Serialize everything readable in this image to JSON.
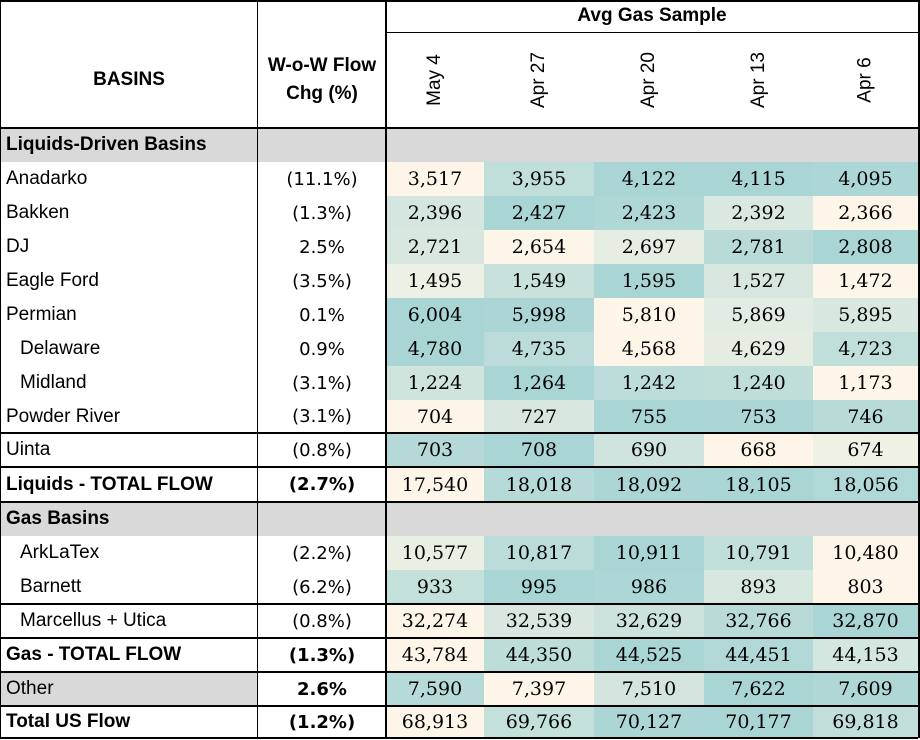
{
  "header": {
    "basins_label": "BASINS",
    "wow_label": "W-o-W Flow Chg (%)",
    "avg_label": "Avg Gas Sample",
    "dates": [
      "May 4",
      "Apr 27",
      "Apr 20",
      "Apr 13",
      "Apr 6"
    ]
  },
  "colors": {
    "heat_low": "#fdf6e8",
    "heat_high": "#a9d5d5",
    "section_gray": "#d9d9d9",
    "grid": "#000000"
  },
  "rows": [
    {
      "type": "section",
      "name": "Liquids-Driven Basins"
    },
    {
      "type": "data",
      "name": "Anadarko",
      "indent": false,
      "chg": "(11.1%)",
      "values": [
        "3,517",
        "3,955",
        "4,122",
        "4,115",
        "4,095"
      ]
    },
    {
      "type": "data",
      "name": "Bakken",
      "indent": false,
      "chg": "(1.3%)",
      "values": [
        "2,396",
        "2,427",
        "2,423",
        "2,392",
        "2,366"
      ]
    },
    {
      "type": "data",
      "name": "DJ",
      "indent": false,
      "chg": "2.5%",
      "values": [
        "2,721",
        "2,654",
        "2,697",
        "2,781",
        "2,808"
      ]
    },
    {
      "type": "data",
      "name": "Eagle Ford",
      "indent": false,
      "chg": "(3.5%)",
      "values": [
        "1,495",
        "1,549",
        "1,595",
        "1,527",
        "1,472"
      ]
    },
    {
      "type": "data",
      "name": "Permian",
      "indent": false,
      "chg": "0.1%",
      "values": [
        "6,004",
        "5,998",
        "5,810",
        "5,869",
        "5,895"
      ]
    },
    {
      "type": "data",
      "name": "Delaware",
      "indent": true,
      "chg": "0.9%",
      "values": [
        "4,780",
        "4,735",
        "4,568",
        "4,629",
        "4,723"
      ]
    },
    {
      "type": "data",
      "name": "Midland",
      "indent": true,
      "chg": "(3.1%)",
      "values": [
        "1,224",
        "1,264",
        "1,242",
        "1,240",
        "1,173"
      ]
    },
    {
      "type": "data",
      "name": "Powder River",
      "indent": false,
      "chg": "(3.1%)",
      "values": [
        "704",
        "727",
        "755",
        "753",
        "746"
      ]
    },
    {
      "type": "data",
      "name": "Uinta",
      "indent": false,
      "chg": "(0.8%)",
      "values": [
        "703",
        "708",
        "690",
        "668",
        "674"
      ]
    },
    {
      "type": "total",
      "name": "Liquids - TOTAL FLOW",
      "chg": "(2.7%)",
      "values": [
        "17,540",
        "18,018",
        "18,092",
        "18,105",
        "18,056"
      ]
    },
    {
      "type": "section",
      "name": "Gas Basins"
    },
    {
      "type": "data",
      "name": "ArkLaTex",
      "indent": true,
      "chg": "(2.2%)",
      "values": [
        "10,577",
        "10,817",
        "10,911",
        "10,791",
        "10,480"
      ]
    },
    {
      "type": "data",
      "name": "Barnett",
      "indent": true,
      "chg": "(6.2%)",
      "values": [
        "933",
        "995",
        "986",
        "893",
        "803"
      ]
    },
    {
      "type": "data",
      "name": "Marcellus + Utica",
      "indent": true,
      "chg": "(0.8%)",
      "values": [
        "32,274",
        "32,539",
        "32,629",
        "32,766",
        "32,870"
      ]
    },
    {
      "type": "total",
      "name": "Gas - TOTAL FLOW",
      "chg": "(1.3%)",
      "values": [
        "43,784",
        "44,350",
        "44,525",
        "44,451",
        "44,153"
      ]
    },
    {
      "type": "other",
      "name": "Other",
      "chg": "2.6%",
      "values": [
        "7,590",
        "7,397",
        "7,510",
        "7,622",
        "7,609"
      ]
    },
    {
      "type": "total",
      "name": "Total US Flow",
      "chg": "(1.2%)",
      "values": [
        "68,913",
        "69,766",
        "70,127",
        "70,177",
        "69,818"
      ]
    }
  ]
}
